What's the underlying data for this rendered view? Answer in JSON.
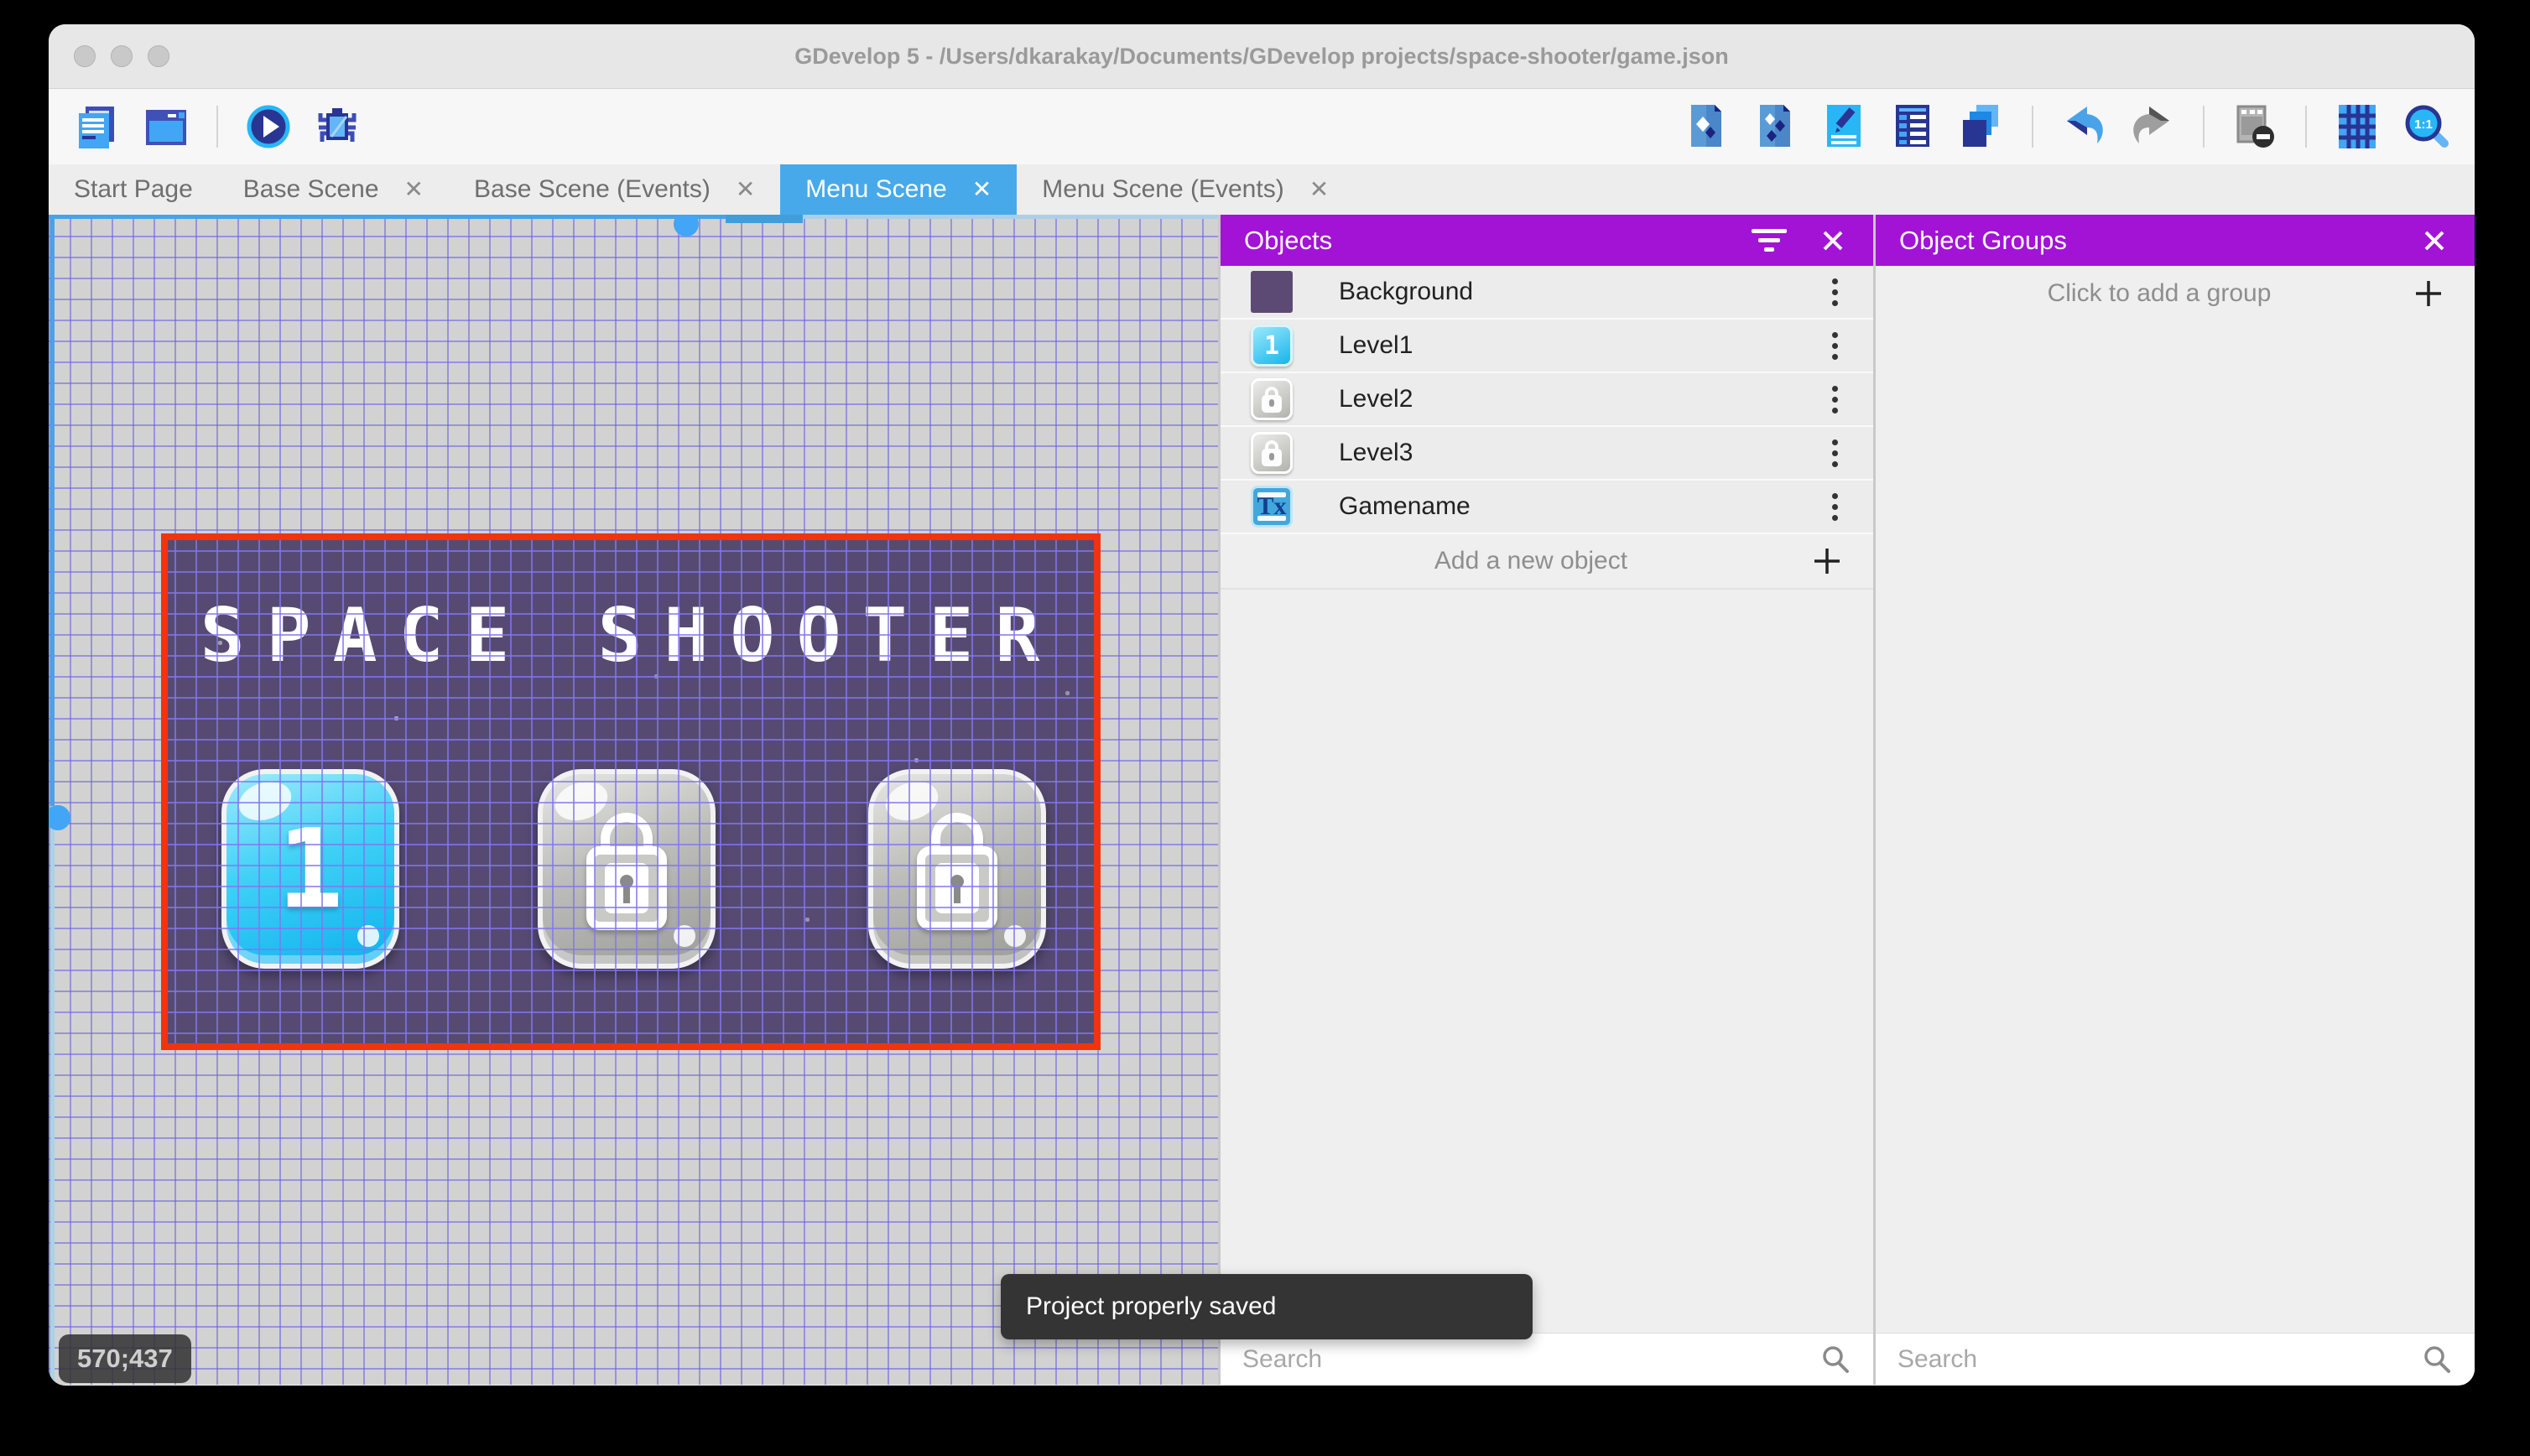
{
  "window": {
    "title": "GDevelop 5 - /Users/dkarakay/Documents/GDevelop projects/space-shooter/game.json"
  },
  "toolbar": {
    "left_icons": [
      "project-manager-icon",
      "scene-editor-icon",
      "play-icon",
      "debug-icon"
    ],
    "right_icons": [
      "add-object-icon",
      "add-object-group-icon",
      "edit-scene-properties-icon",
      "instances-list-icon",
      "layers-editor-icon",
      "undo-icon",
      "redo-icon",
      "window-mask-icon",
      "grid-icon",
      "zoom-ratio-icon"
    ],
    "zoom_ratio_label": "1:1"
  },
  "tabs": [
    {
      "label": "Start Page",
      "closable": false,
      "active": false
    },
    {
      "label": "Base Scene",
      "closable": true,
      "active": false
    },
    {
      "label": "Base Scene (Events)",
      "closable": true,
      "active": false
    },
    {
      "label": "Menu Scene",
      "closable": true,
      "active": true
    },
    {
      "label": "Menu Scene (Events)",
      "closable": true,
      "active": false
    }
  ],
  "canvas": {
    "coordinates": "570;437",
    "scene": {
      "title": "SPACE SHOOTER",
      "buttons": [
        {
          "glyph": "1",
          "state": "unlocked"
        },
        {
          "state": "locked"
        },
        {
          "state": "locked"
        }
      ]
    }
  },
  "objects_panel": {
    "title": "Objects",
    "items": [
      {
        "label": "Background",
        "icon": "background-object-icon"
      },
      {
        "label": "Level1",
        "icon": "level1-button-icon",
        "icon_glyph": "1"
      },
      {
        "label": "Level2",
        "icon": "locked-button-icon"
      },
      {
        "label": "Level3",
        "icon": "locked-button-icon"
      },
      {
        "label": "Gamename",
        "icon": "text-object-icon",
        "icon_glyph": "Tx"
      }
    ],
    "add_label": "Add a new object",
    "search_placeholder": "Search"
  },
  "groups_panel": {
    "title": "Object Groups",
    "add_label": "Click to add a group",
    "search_placeholder": "Search"
  },
  "toast": {
    "message": "Project properly saved"
  },
  "colors": {
    "accent_purple": "#a213d6",
    "active_tab_blue": "#47a9e9",
    "selection_red": "#f2330f",
    "scene_purple": "#564a72",
    "grid_line": "#6e63dd",
    "canvas_gray": "#d2d2d2",
    "toast_bg": "#343434"
  }
}
